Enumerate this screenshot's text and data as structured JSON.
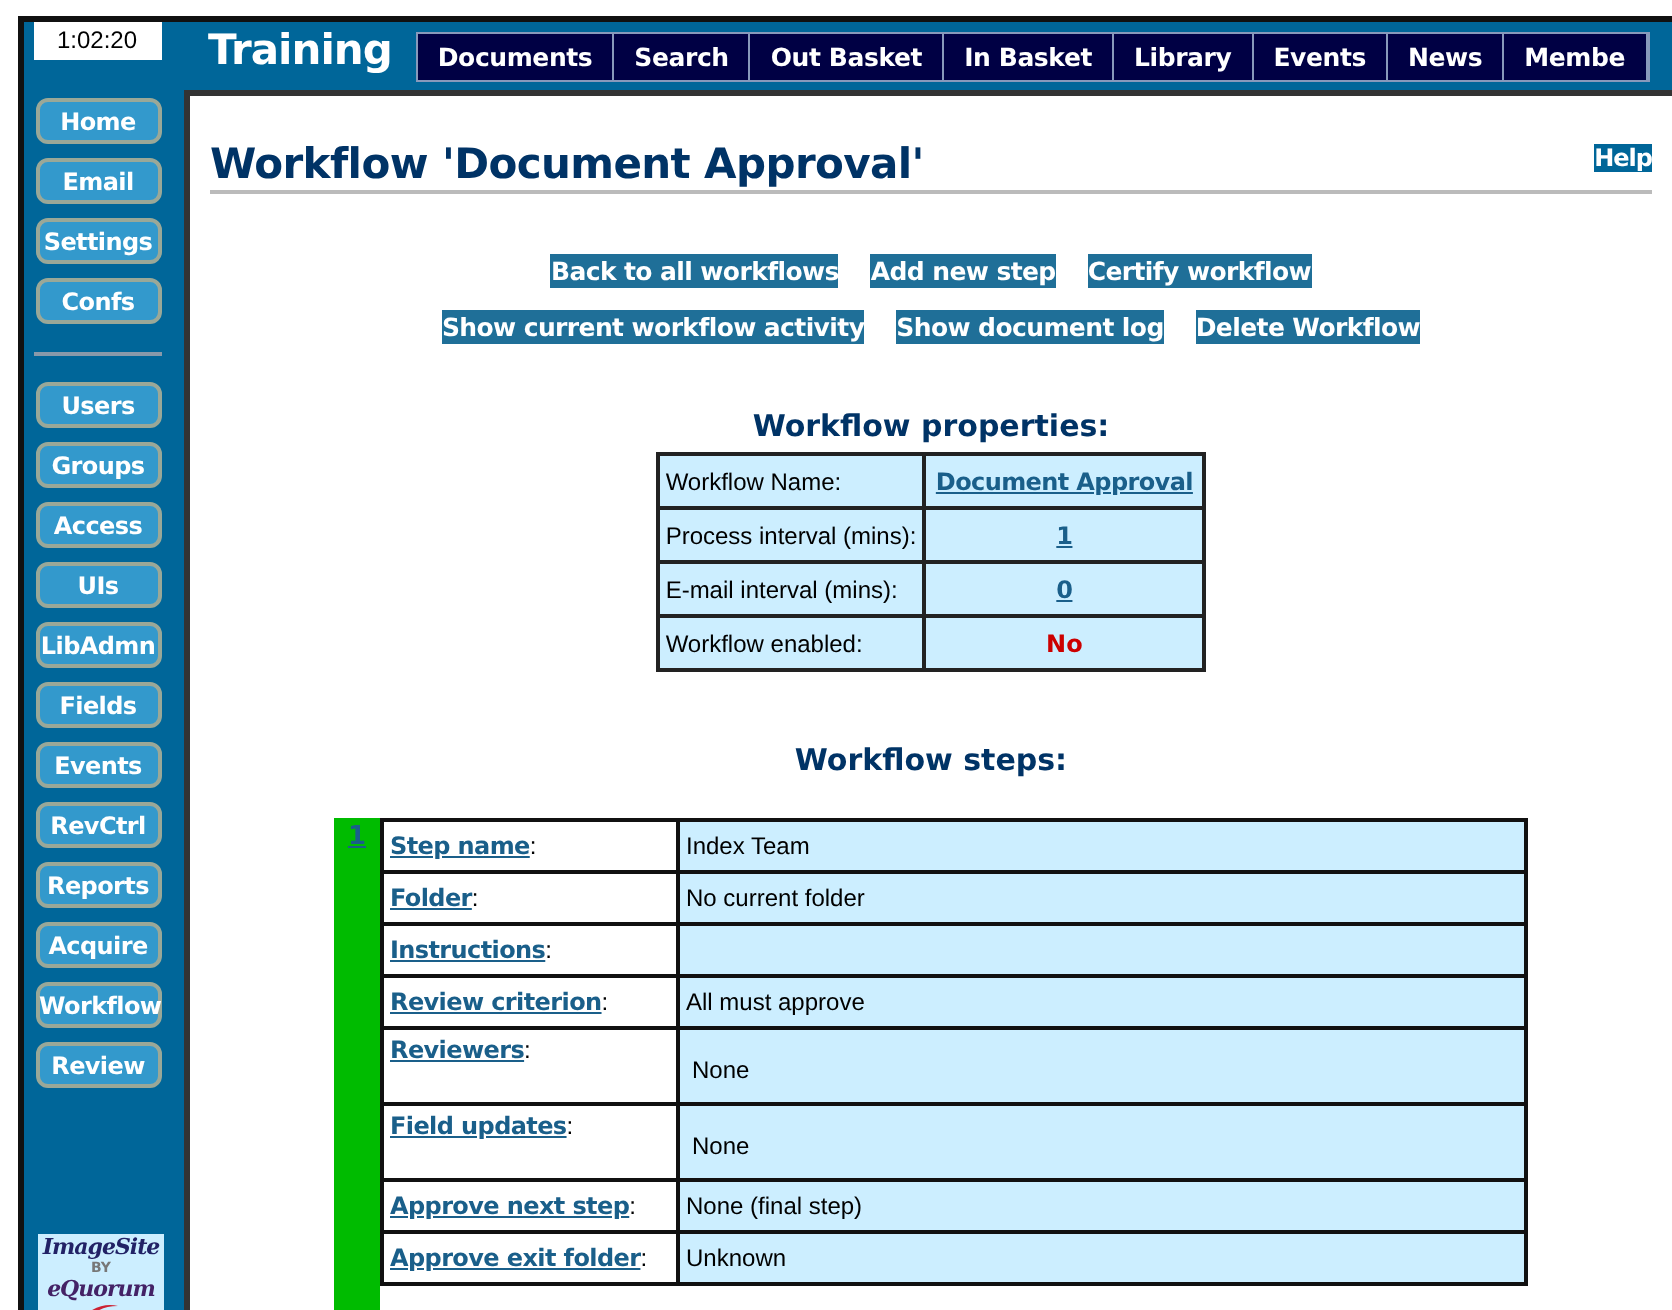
{
  "clock": "1:02:20",
  "site_title": "Training",
  "nav_tabs": [
    "Documents",
    "Search",
    "Out Basket",
    "In Basket",
    "Library",
    "Events",
    "News",
    "Membe"
  ],
  "sidebar": {
    "sections": [
      {
        "items": [
          "Home",
          "Email",
          "Settings",
          "Confs"
        ]
      },
      {
        "items": [
          "Users",
          "Groups",
          "Access",
          "UIs",
          "LibAdmn",
          "Fields",
          "Events",
          "RevCtrl",
          "Reports",
          "Acquire",
          "Workflow",
          "Review"
        ]
      }
    ]
  },
  "logo": {
    "name": "ImageSite",
    "by": "BY",
    "company": "eQuorum"
  },
  "page": {
    "title": "Workflow 'Document Approval'",
    "help": "Help",
    "action_rows": [
      [
        "Back to all workflows",
        "Add new step",
        "Certify workflow"
      ],
      [
        "Show current workflow activity",
        "Show document log",
        "Delete Workflow"
      ]
    ],
    "properties": {
      "heading": "Workflow properties:",
      "rows": [
        {
          "label": "Workflow Name:",
          "value": "Document Approval",
          "kind": "link"
        },
        {
          "label": "Process interval (mins):",
          "value": "1",
          "kind": "link"
        },
        {
          "label": "E-mail interval (mins):",
          "value": "0",
          "kind": "link"
        },
        {
          "label": "Workflow enabled:",
          "value": "No",
          "kind": "alert"
        }
      ]
    },
    "steps": {
      "heading": "Workflow steps:",
      "items": [
        {
          "number": "1",
          "fields": [
            {
              "label": "Step name",
              "suffix": ":",
              "value": "Index Team",
              "kind": "text"
            },
            {
              "label": "Folder",
              "suffix": ":",
              "value": "No current folder",
              "kind": "text"
            },
            {
              "label": "Instructions",
              "suffix": ":",
              "kind": "text"
            },
            {
              "label": "Review criterion",
              "suffix": ":",
              "value": "All must approve",
              "kind": "text"
            },
            {
              "label": "Reviewers",
              "suffix": ":",
              "value": "None",
              "kind": "list"
            },
            {
              "label": "Field updates",
              "suffix": ":",
              "value": "None",
              "kind": "list"
            },
            {
              "label": "Approve next step",
              "suffix": ":",
              "value": "None (final step)",
              "kind": "text"
            },
            {
              "label": "Approve exit folder",
              "suffix": ":",
              "value": "Unknown",
              "kind": "text"
            }
          ]
        }
      ]
    }
  }
}
